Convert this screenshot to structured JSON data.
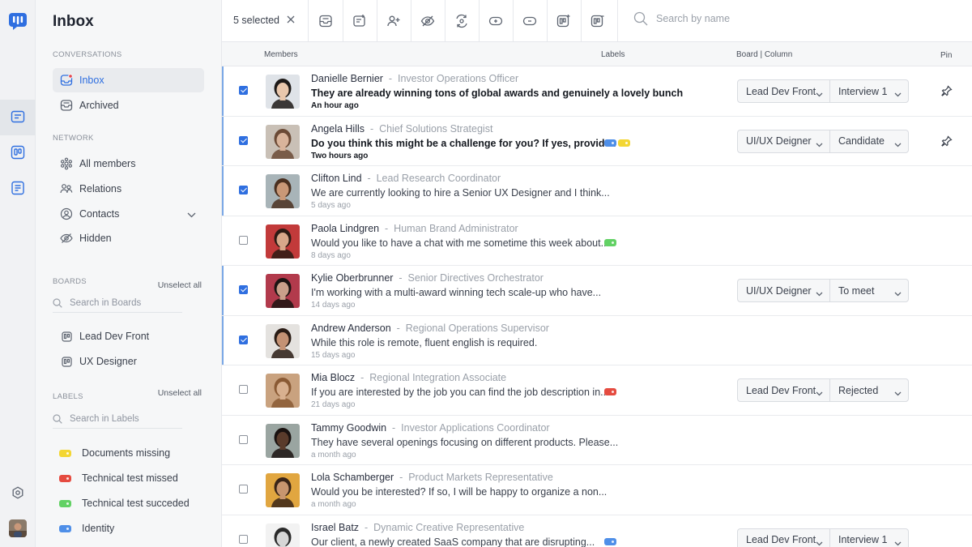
{
  "sidebar": {
    "title": "Inbox",
    "conversations_label": "CONVERSATIONS",
    "conversations": [
      "Inbox",
      "Archived"
    ],
    "network_label": "NETWORK",
    "network": [
      "All members",
      "Relations",
      "Contacts",
      "Hidden"
    ],
    "boards_label": "BOARDS",
    "boards_unselect": "Unselect all",
    "boards_search_placeholder": "Search in Boards",
    "boards": [
      "Lead Dev Front",
      "UX Designer"
    ],
    "labels_label": "LABELS",
    "labels_unselect": "Unselect all",
    "labels_search_placeholder": "Search in Labels",
    "labels": [
      {
        "name": "Documents missing",
        "color": "#f3d633"
      },
      {
        "name": "Technical test missed",
        "color": "#e54b40"
      },
      {
        "name": "Technical test succeded",
        "color": "#62d164"
      },
      {
        "name": "Identity",
        "color": "#4f8fe8"
      }
    ]
  },
  "toolbar": {
    "selected": "5 selected",
    "search_placeholder": "Search by name",
    "icons": [
      "archive-icon",
      "move-to-board-icon",
      "add-member-icon",
      "hide-icon",
      "relation-icon",
      "label-icon",
      "unlabel-icon",
      "board-icon",
      "board-remove-icon"
    ]
  },
  "table": {
    "headers": {
      "members": "Members",
      "labels": "Labels",
      "board": "Board | Column",
      "pin": "Pin"
    },
    "rows": [
      {
        "name": "Danielle Bernier",
        "role": "Investor Operations Officer",
        "message": "They are already winning tons of global awards and genuinely a lovely bunch",
        "time": "An hour ago",
        "checked": true,
        "unread": true,
        "labels": [],
        "board": "Lead Dev Front",
        "column": "Interview 1",
        "pinned": true,
        "skin": "#e9c7ac",
        "hair": "#1e1a18",
        "bg": "#dfe3e8"
      },
      {
        "name": "Angela Hills",
        "role": "Chief Solutions Strategist",
        "message": "Do you think this might be a challenge for you? If yes, provide..",
        "time": "Two hours ago",
        "checked": true,
        "unread": true,
        "labels": [
          "#4f8fe8",
          "#f3d633"
        ],
        "board": "UI/UX Deigner",
        "column": "Candidate",
        "pinned": true,
        "skin": "#d9b49b",
        "hair": "#6b4a36",
        "bg": "#c9c0b6"
      },
      {
        "name": "Clifton Lind",
        "role": "Lead Research Coordinator",
        "message": "We are currently looking to hire a Senior UX Designer and I think...",
        "time": "5 days ago",
        "checked": true,
        "unread": false,
        "labels": [],
        "board": "",
        "column": "",
        "pinned": false,
        "skin": "#c99877",
        "hair": "#4a3020",
        "bg": "#a8b4b8"
      },
      {
        "name": "Paola Lindgren",
        "role": "Human Brand Administrator",
        "message": "Would you like to have a chat with me sometime this week about...",
        "time": "8 days ago",
        "checked": false,
        "unread": false,
        "labels": [
          "#62d164"
        ],
        "board": "",
        "column": "",
        "pinned": false,
        "skin": "#d7a88a",
        "hair": "#2b1b14",
        "bg": "#c23a3a"
      },
      {
        "name": "Kylie Oberbrunner",
        "role": "Senior Directives Orchestrator",
        "message": "I'm working with a multi-award winning tech scale-up who have...",
        "time": "14 days ago",
        "checked": true,
        "unread": false,
        "labels": [],
        "board": "UI/UX Deigner",
        "column": "To meet",
        "pinned": false,
        "skin": "#caa08a",
        "hair": "#1c1412",
        "bg": "#b23a4c"
      },
      {
        "name": "Andrew Anderson",
        "role": "Regional Operations Supervisor",
        "message": "While this role is remote, fluent english is required.",
        "time": "15 days ago",
        "checked": true,
        "unread": false,
        "labels": [],
        "board": "",
        "column": "",
        "pinned": false,
        "skin": "#c49274",
        "hair": "#2a1c15",
        "bg": "#e4e2df"
      },
      {
        "name": "Mia Blocz",
        "role": "Regional Integration Associate",
        "message": "If you are interested by the job you can find the job description in...",
        "time": "21 days ago",
        "checked": false,
        "unread": false,
        "labels": [
          "#e54b40"
        ],
        "board": "Lead Dev Front",
        "column": "Rejected",
        "pinned": false,
        "skin": "#d8b08f",
        "hair": "#8a5a34",
        "bg": "#c9a27f"
      },
      {
        "name": "Tammy Goodwin",
        "role": "Investor Applications Coordinator",
        "message": "They have several openings focusing on different products. Please...",
        "time": "a month ago",
        "checked": false,
        "unread": false,
        "labels": [],
        "board": "",
        "column": "",
        "pinned": false,
        "skin": "#5a3b2b",
        "hair": "#1a1210",
        "bg": "#9aa5a1"
      },
      {
        "name": "Lola Schamberger",
        "role": "Product Markets Representative",
        "message": "Would you be interested? If so, I will be happy to organize a non...",
        "time": "a month ago",
        "checked": false,
        "unread": false,
        "labels": [],
        "board": "",
        "column": "",
        "pinned": false,
        "skin": "#c8956f",
        "hair": "#3a2418",
        "bg": "#e1a640"
      },
      {
        "name": "Israel Batz",
        "role": "Dynamic Creative Representative",
        "message": "Our client, a newly created SaaS company that are disrupting...",
        "time": "",
        "checked": false,
        "unread": false,
        "labels": [
          "#4f8fe8"
        ],
        "board": "Lead Dev Front",
        "column": "Interview 1",
        "pinned": false,
        "skin": "#d6d6d6",
        "hair": "#2a2a2a",
        "bg": "#f2f2f2"
      }
    ]
  }
}
